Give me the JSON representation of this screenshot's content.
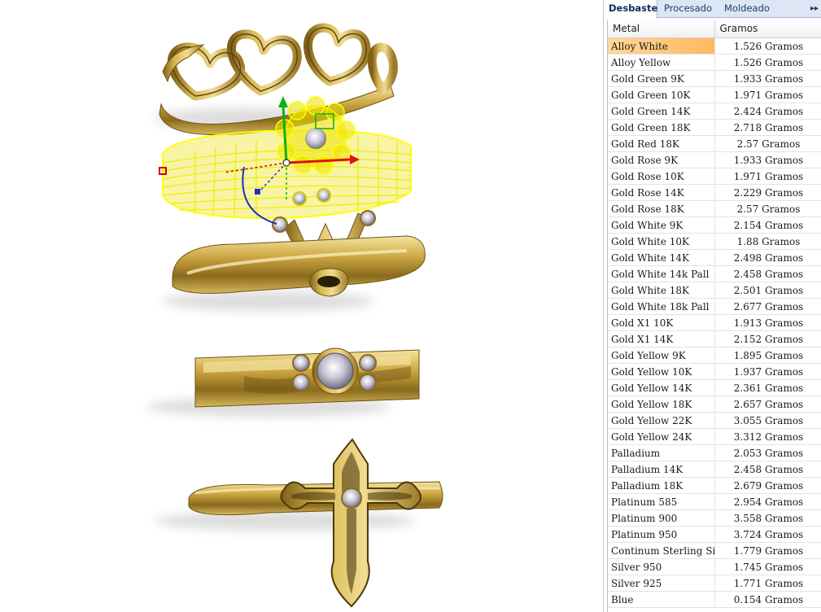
{
  "tabs": [
    {
      "label": "Desbaste",
      "active": true
    },
    {
      "label": "Procesado",
      "active": false
    },
    {
      "label": "Moldeado",
      "active": false
    }
  ],
  "overflow_glyph": "▸▸",
  "table": {
    "columns": [
      "Metal",
      "Gramos"
    ],
    "selected_index": 0,
    "rows": [
      {
        "metal": "Alloy White",
        "grams": "1.526 Gramos"
      },
      {
        "metal": "Alloy Yellow",
        "grams": "1.526 Gramos"
      },
      {
        "metal": "Gold Green 9K",
        "grams": "1.933 Gramos"
      },
      {
        "metal": "Gold Green 10K",
        "grams": "1.971 Gramos"
      },
      {
        "metal": "Gold Green 14K",
        "grams": "2.424 Gramos"
      },
      {
        "metal": "Gold Green 18K",
        "grams": "2.718 Gramos"
      },
      {
        "metal": "Gold Red 18K",
        "grams": "2.57 Gramos"
      },
      {
        "metal": "Gold Rose 9K",
        "grams": "1.933 Gramos"
      },
      {
        "metal": "Gold Rose 10K",
        "grams": "1.971 Gramos"
      },
      {
        "metal": "Gold Rose 14K",
        "grams": "2.229 Gramos"
      },
      {
        "metal": "Gold Rose 18K",
        "grams": "2.57 Gramos"
      },
      {
        "metal": "Gold White 9K",
        "grams": "2.154 Gramos"
      },
      {
        "metal": "Gold White 10K",
        "grams": "1.88 Gramos"
      },
      {
        "metal": "Gold White 14K",
        "grams": "2.498 Gramos"
      },
      {
        "metal": "Gold White 14k Pall",
        "grams": "2.458 Gramos"
      },
      {
        "metal": "Gold White 18K",
        "grams": "2.501 Gramos"
      },
      {
        "metal": "Gold White 18k Pall",
        "grams": "2.677 Gramos"
      },
      {
        "metal": "Gold X1 10K",
        "grams": "1.913 Gramos"
      },
      {
        "metal": "Gold X1 14K",
        "grams": "2.152 Gramos"
      },
      {
        "metal": "Gold Yellow 9K",
        "grams": "1.895 Gramos"
      },
      {
        "metal": "Gold Yellow 10K",
        "grams": "1.937 Gramos"
      },
      {
        "metal": "Gold Yellow 14K",
        "grams": "2.361 Gramos"
      },
      {
        "metal": "Gold Yellow 18K",
        "grams": "2.657 Gramos"
      },
      {
        "metal": "Gold Yellow 22K",
        "grams": "3.055 Gramos"
      },
      {
        "metal": "Gold Yellow 24K",
        "grams": "3.312 Gramos"
      },
      {
        "metal": "Palladium",
        "grams": "2.053 Gramos"
      },
      {
        "metal": "Palladium 14K",
        "grams": "2.458 Gramos"
      },
      {
        "metal": "Palladium 18K",
        "grams": "2.679 Gramos"
      },
      {
        "metal": "Platinum 585",
        "grams": "2.954 Gramos"
      },
      {
        "metal": "Platinum 900",
        "grams": "3.558 Gramos"
      },
      {
        "metal": "Platinum 950",
        "grams": "3.724 Gramos"
      },
      {
        "metal": "Continum Sterling Silver",
        "grams": "1.779 Gramos"
      },
      {
        "metal": "Silver 950",
        "grams": "1.745 Gramos"
      },
      {
        "metal": "Silver 925",
        "grams": "1.771 Gramos"
      },
      {
        "metal": "Blue",
        "grams": "0.154 Gramos"
      }
    ]
  },
  "colors": {
    "gold": "#c9a640",
    "gold_dark": "#7a5a14",
    "wireframe": "#ffff00",
    "selection": "#ffb860",
    "tab_bg": "#dce6f4"
  }
}
